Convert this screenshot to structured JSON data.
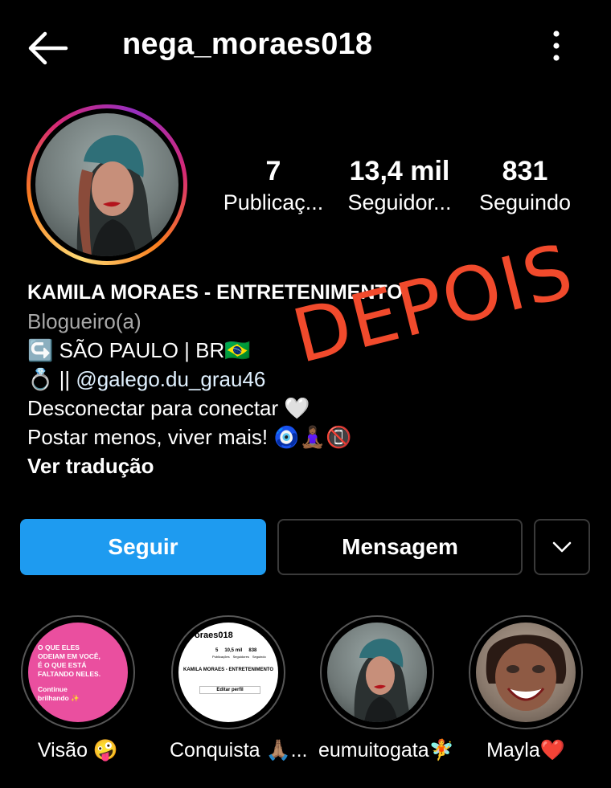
{
  "header": {
    "username": "nega_moraes018",
    "back_icon": "arrow-left-icon",
    "more_icon": "more-vertical-icon"
  },
  "profile": {
    "avatar_icon": "profile-photo",
    "stats": [
      {
        "value": "7",
        "label": "Publicaç..."
      },
      {
        "value": "13,4 mil",
        "label": "Seguidor..."
      },
      {
        "value": "831",
        "label": "Seguindo"
      }
    ]
  },
  "bio": {
    "name": "KAMILA MORAES - ENTRETENIMENTO",
    "category": "Blogueiro(a)",
    "line1": "↪️ SÃO PAULO | BR🇧🇷",
    "line2_prefix": "💍 || ",
    "line2_link": "@galego.du_grau46",
    "line3": "Desconectar para conectar 🤍",
    "line4": "Postar menos, viver mais! 🧿🧘🏾‍♀️📵",
    "translate": "Ver tradução"
  },
  "stamp": "DEPOIS",
  "actions": {
    "follow": "Seguir",
    "message": "Mensagem",
    "dropdown_icon": "chevron-down-icon"
  },
  "highlights": [
    {
      "label": "Visão 🤪",
      "cover": {
        "lines": [
          "O QUE ELES",
          "ODEIAM EM VOCÊ,",
          "É O QUE ESTÁ",
          "FALTANDO NELES."
        ],
        "sub": [
          "Continue",
          "brilhando ✨"
        ]
      }
    },
    {
      "label": "Conquista 🙏🏽...",
      "cover": {
        "title": "oraes018",
        "stats": [
          "5",
          "10,5 mil",
          "838"
        ],
        "stat_labels": [
          "Publicações",
          "Seguidores",
          "Seguindo"
        ],
        "name": "KAMILA MORAES - ENTRETENIMENTO",
        "edit": "Editar perfil"
      }
    },
    {
      "label": "eumuitogata🧚"
    },
    {
      "label": "Mayla❤️"
    }
  ],
  "colors": {
    "accent": "#1e9bf0",
    "stamp": "#f14a2c",
    "highlight_pink": "#ea4f9f"
  }
}
